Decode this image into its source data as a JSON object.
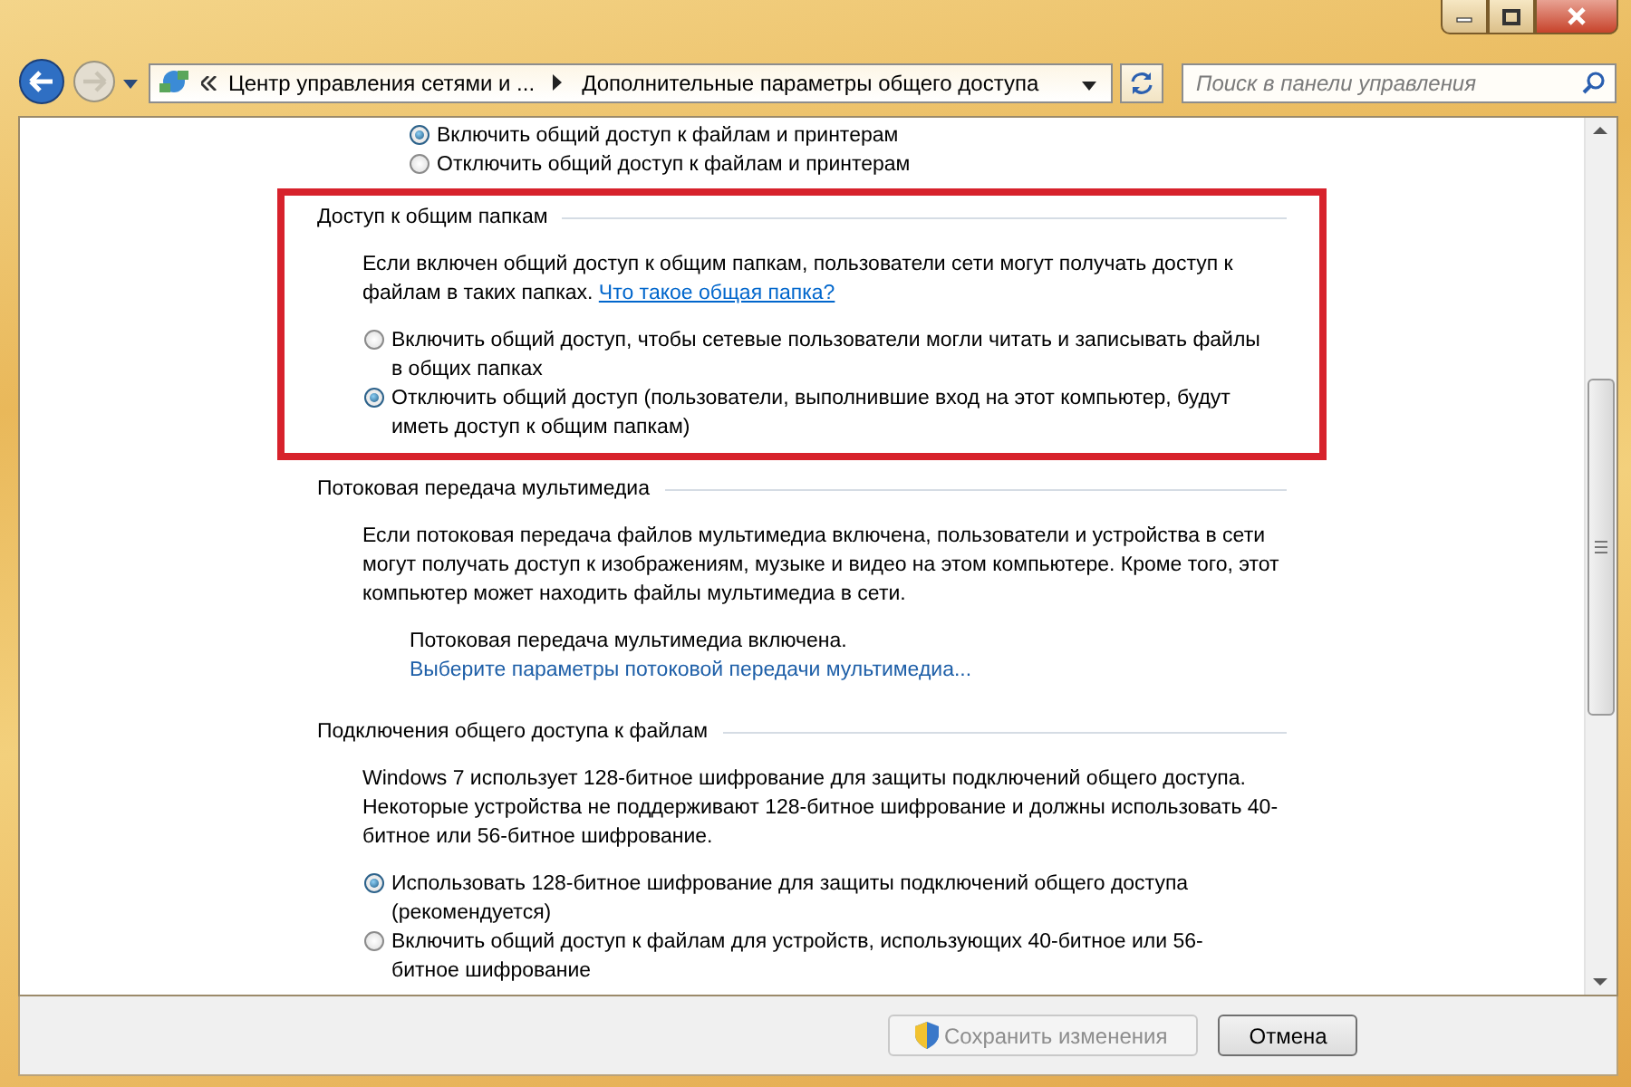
{
  "window": {
    "controls": [
      {
        "kind": "minimize"
      },
      {
        "kind": "maximize"
      },
      {
        "kind": "close"
      }
    ]
  },
  "address_bar": {
    "breadcrumbs": [
      "Центр управления сетями и ...",
      "Дополнительные параметры общего доступа"
    ],
    "search": {
      "placeholder": "Поиск в панели управления"
    }
  },
  "top_options": [
    {
      "label": "Включить общий доступ к файлам и принтерам",
      "selected": true
    },
    {
      "label": "Отключить общий доступ к файлам и принтерам",
      "selected": false
    }
  ],
  "sections": [
    {
      "title": "Доступ к общим папкам",
      "highlighted": true,
      "description": "Если включен общий доступ к общим папкам, пользователи сети могут получать доступ к файлам в таких папках.",
      "help_link": "Что такое общая папка?",
      "options": [
        {
          "label": "Включить общий доступ, чтобы сетевые пользователи могли читать и записывать файлы в общих папках",
          "selected": false
        },
        {
          "label": "Отключить общий доступ (пользователи, выполнившие вход на этот компьютер, будут иметь доступ к общим папкам)",
          "selected": true
        }
      ]
    },
    {
      "title": "Потоковая передача мультимедиа",
      "highlighted": false,
      "description": "Если потоковая передача файлов мультимедиа включена, пользователи и устройства в сети могут получать доступ к изображениям, музыке и видео на этом компьютере. Кроме того, этот компьютер может находить файлы мультимедиа в сети.",
      "status": "Потоковая передача мультимедиа включена.",
      "settings_link": "Выберите параметры потоковой передачи мультимедиа..."
    },
    {
      "title": "Подключения общего доступа к файлам",
      "highlighted": false,
      "description": "Windows 7 использует 128-битное шифрование для защиты подключений общего доступа. Некоторые устройства не поддерживают 128-битное шифрование и должны использовать 40-битное или 56-битное шифрование.",
      "options": [
        {
          "label": "Использовать 128-битное шифрование для защиты подключений общего доступа (рекомендуется)",
          "selected": true
        },
        {
          "label": "Включить общий доступ к файлам для устройств, использующих 40-битное или 56-битное шифрование",
          "selected": false
        }
      ]
    }
  ],
  "buttons": [
    {
      "label": "Сохранить изменения",
      "kind": "shield",
      "disabled": true
    },
    {
      "label": "Отмена",
      "kind": "plain",
      "disabled": false
    }
  ]
}
